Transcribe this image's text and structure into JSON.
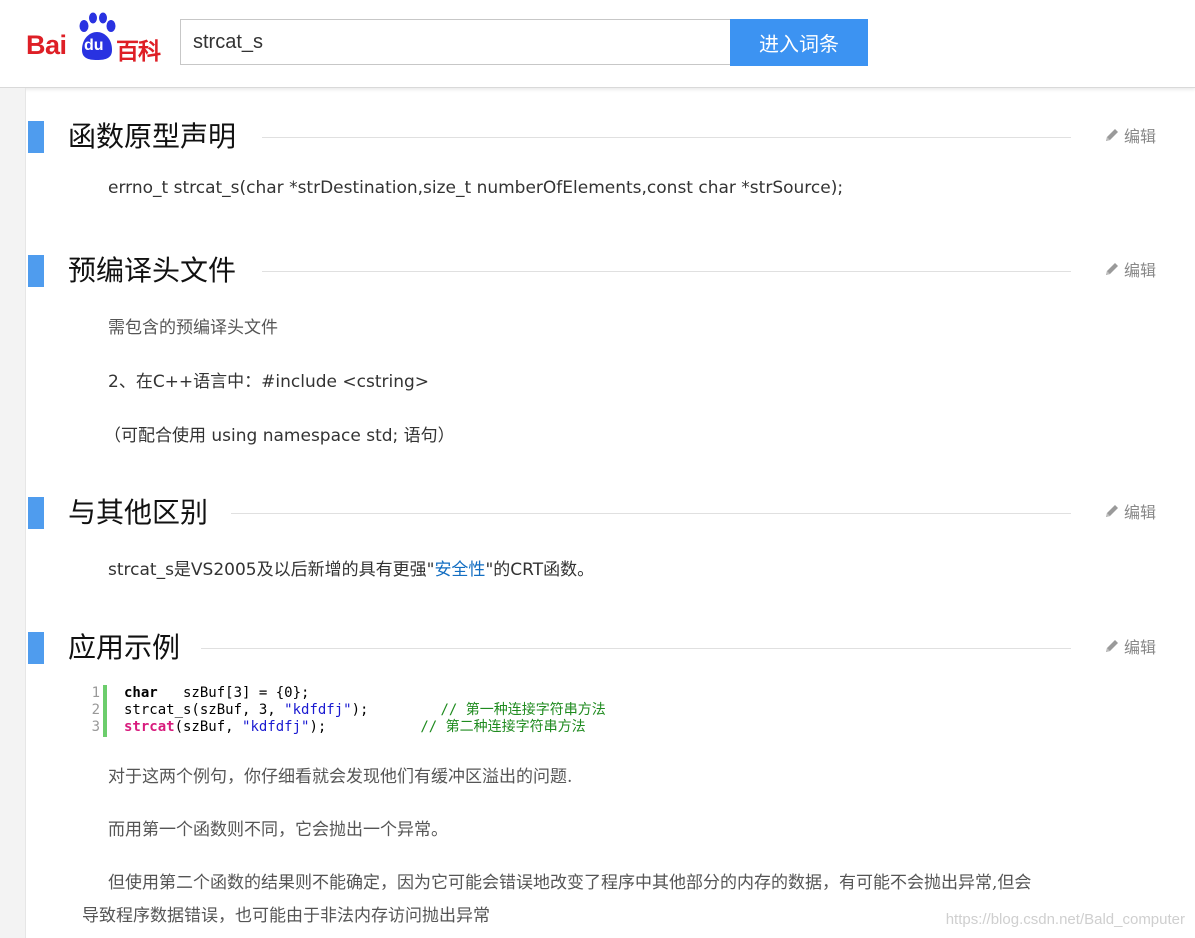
{
  "header": {
    "logo_bai": "Bai",
    "logo_du": "du",
    "logo_baike": "百科",
    "search_value": "strcat_s",
    "search_button": "进入词条"
  },
  "sections": [
    {
      "title": "函数原型声明",
      "edit_label": "编辑",
      "paragraphs": [
        "errno_t strcat_s(char *strDestination,size_t numberOfElements,const char *strSource);"
      ]
    },
    {
      "title": "预编译头文件",
      "edit_label": "编辑",
      "paragraphs": [
        "需包含的预编译头文件",
        "2、在C++语言中：#include <cstring>",
        "（可配合使用 using namespace std; 语句）"
      ]
    },
    {
      "title": "与其他区别",
      "edit_label": "编辑",
      "paragraph_parts": {
        "before": "strcat_s是VS2005及以后新增的具有更强\"",
        "link": "安全性",
        "after": "\"的CRT函数。"
      }
    },
    {
      "title": "应用示例",
      "edit_label": "编辑",
      "code": {
        "line_numbers": [
          "1",
          "2",
          "3"
        ],
        "lines": [
          {
            "kw": "char",
            "rest": "   szBuf[3] = {0};"
          },
          {
            "plain": "strcat_s(szBuf, 3, ",
            "str": "\"kdfdfj\"",
            "after": ");",
            "comment": "// 第一种连接字符串方法"
          },
          {
            "fn": "strcat",
            "plain": "(szBuf, ",
            "str": "\"kdfdfj\"",
            "after": ");",
            "comment": "// 第二种连接字符串方法"
          }
        ]
      },
      "paragraphs": [
        "对于这两个例句，你仔细看就会发现他们有缓冲区溢出的问题.",
        "而用第一个函数则不同，它会抛出一个异常。",
        "但使用第二个函数的结果则不能确定，因为它可能会错误地改变了程序中其他部分的内存的数据，有可能不会抛出异常,但会",
        "导致程序数据错误，也可能由于非法内存访问抛出异常"
      ]
    }
  ],
  "watermark": "https://blog.csdn.net/Bald_computer",
  "colors": {
    "accent_bar": "#4f9cee",
    "search_button": "#3c93f2",
    "logo_red": "#de1f26",
    "logo_blue": "#2932e1",
    "link": "#136ec2"
  }
}
